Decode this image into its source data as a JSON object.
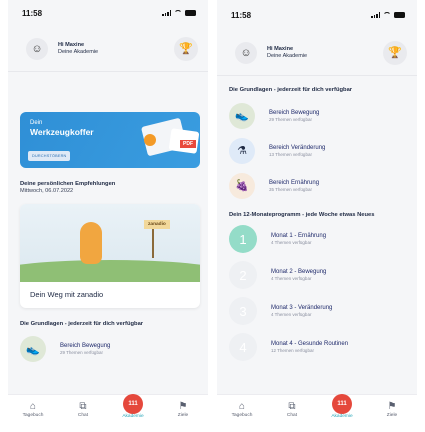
{
  "status": {
    "time": "11:58"
  },
  "profile": {
    "greeting": "Hi Maxine",
    "subtitle": "Deine Akademie"
  },
  "hero": {
    "small": "Dein",
    "big": "Werkzeugkoffer",
    "button": "DURCHSTÖBERN",
    "badge": "PDF"
  },
  "recommend": {
    "title": "Deine persönlichen Empfehlungen",
    "date": "Mittwoch, 06.07.2022"
  },
  "promo": {
    "sign": "zanadio",
    "caption": "Dein Weg mit zanadio"
  },
  "basics": {
    "title": "Die Grundlagen - jederzeit für dich verfügbar",
    "items": [
      {
        "title": "Bereich Bewegung",
        "sub": "29 Themen verfügbar",
        "icon": "shoe-icon",
        "color": "#dfe8d7"
      },
      {
        "title": "Bereich Veränderung",
        "sub": "13 Themen verfügbar",
        "icon": "change-icon",
        "color": "#dfeaf8"
      },
      {
        "title": "Bereich Ernährung",
        "sub": "35 Themen verfügbar",
        "icon": "food-icon",
        "color": "#f7eadd"
      }
    ]
  },
  "program": {
    "title": "Dein 12-Monateprogramm - jede Woche etwas Neues",
    "months": [
      {
        "num": "1",
        "title": "Monat 1 - Ernährung",
        "sub": "4 Themen verfügbar"
      },
      {
        "num": "2",
        "title": "Monat 2 - Bewegung",
        "sub": "4 Themen verfügbar"
      },
      {
        "num": "3",
        "title": "Monat 3 - Veränderung",
        "sub": "4 Themen verfügbar"
      },
      {
        "num": "4",
        "title": "Monat 4 - Gesunde Routinen",
        "sub": "12 Themen verfügbar"
      }
    ]
  },
  "tabs": [
    {
      "label": "Tagebuch",
      "icon": "home-icon"
    },
    {
      "label": "Chat",
      "icon": "chat-icon"
    },
    {
      "label": "Akademie",
      "icon": "academy-icon",
      "badge": "111",
      "active": true
    },
    {
      "label": "Ziele",
      "icon": "flag-icon"
    }
  ],
  "colors": {
    "accent": "#2aa6b8",
    "badge": "#e5483c",
    "hero": "#3a9de0",
    "month_active": "#94dcc8"
  }
}
